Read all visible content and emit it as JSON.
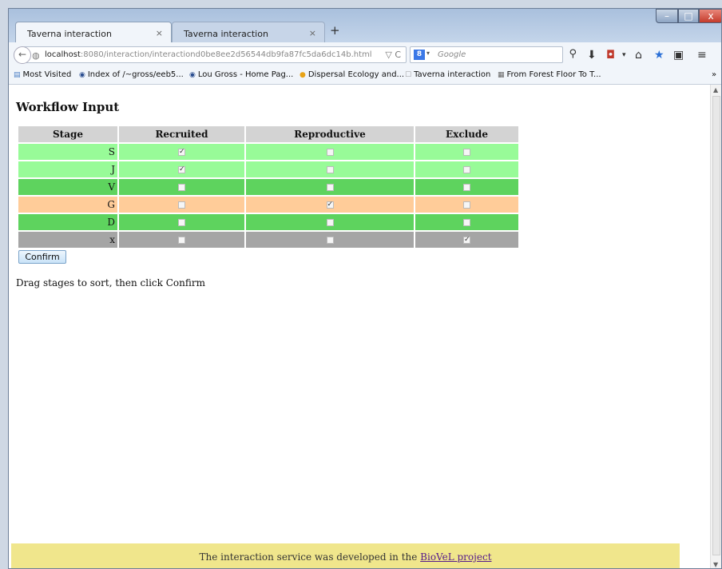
{
  "browser": {
    "tabs": [
      {
        "label": "Taverna interaction",
        "close": "×"
      },
      {
        "label": "Taverna interaction",
        "close": "×"
      }
    ],
    "new_tab": "+",
    "window_controls": {
      "minimize": "–",
      "maximize": "□",
      "close": "x"
    },
    "url_host": "localhost",
    "url_rest": ":8080/interaction/interactiond0be8ee2d56544db9fa87fc5da6dc14b.html",
    "url_icons": "▽ C",
    "search_engine_letter": "8",
    "search_placeholder": "Google",
    "toolbar_icons": [
      "search-icon",
      "download-icon",
      "pocket-icon",
      "home-icon",
      "bookmark-star-icon",
      "clipboard-icon",
      "menu-icon"
    ],
    "bookmarks": [
      {
        "label": "Most Visited",
        "icon": "bookmarks-folder-icon"
      },
      {
        "label": "Index of /~gross/eeb5...",
        "icon": "eye-icon"
      },
      {
        "label": "Lou Gross - Home Pag...",
        "icon": "eye-icon"
      },
      {
        "label": "Dispersal Ecology and...",
        "icon": "firefox-icon"
      },
      {
        "label": "Taverna interaction",
        "icon": "page-icon"
      },
      {
        "label": "From Forest Floor To T...",
        "icon": "grid-icon"
      }
    ],
    "bookmarks_overflow": "»"
  },
  "page": {
    "title": "Workflow Input",
    "table": {
      "headers": [
        "Stage",
        "Recruited",
        "Reproductive",
        "Exclude"
      ],
      "rows": [
        {
          "stage": "S",
          "recruited": true,
          "reproductive": false,
          "exclude": false,
          "color": "#98fb98"
        },
        {
          "stage": "J",
          "recruited": true,
          "reproductive": false,
          "exclude": false,
          "color": "#98fb98"
        },
        {
          "stage": "V",
          "recruited": false,
          "reproductive": false,
          "exclude": false,
          "color": "#5ed35e"
        },
        {
          "stage": "G",
          "recruited": false,
          "reproductive": true,
          "exclude": false,
          "color": "#ffcc99"
        },
        {
          "stage": "D",
          "recruited": false,
          "reproductive": false,
          "exclude": false,
          "color": "#5ed35e"
        },
        {
          "stage": "x",
          "recruited": false,
          "reproductive": false,
          "exclude": true,
          "color": "#a5a5a5"
        }
      ]
    },
    "confirm_label": "Confirm",
    "instructions": "Drag stages to sort, then click Confirm",
    "footer_text": "The interaction service was developed in the ",
    "footer_link": "BioVeL project",
    "colors": {
      "footer_bg": "#f0e68c",
      "header_bg": "#d3d3d3"
    }
  }
}
